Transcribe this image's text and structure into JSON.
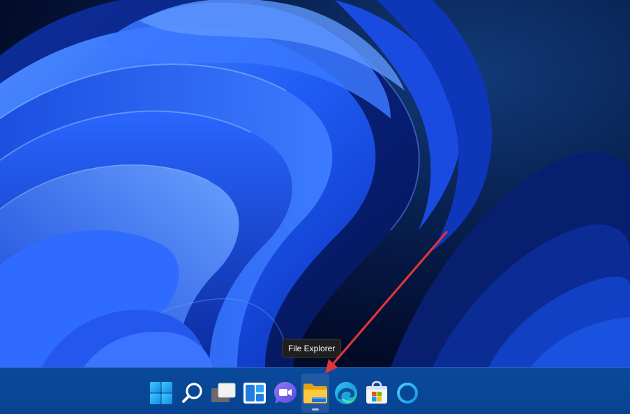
{
  "tooltip": {
    "text": "File Explorer"
  },
  "taskbar": {
    "items": [
      {
        "name": "start-button",
        "icon": "windows-logo-icon",
        "active": false
      },
      {
        "name": "search-button",
        "icon": "search-icon",
        "active": false
      },
      {
        "name": "task-view-button",
        "icon": "task-view-icon",
        "active": false
      },
      {
        "name": "widgets-button",
        "icon": "widgets-icon",
        "active": false
      },
      {
        "name": "teams-chat-button",
        "icon": "teams-chat-icon",
        "active": false
      },
      {
        "name": "file-explorer-button",
        "icon": "folder-icon",
        "active": true
      },
      {
        "name": "edge-button",
        "icon": "edge-icon",
        "active": false
      },
      {
        "name": "microsoft-store-button",
        "icon": "store-icon",
        "active": false
      },
      {
        "name": "cortana-button",
        "icon": "cortana-icon",
        "active": false
      }
    ]
  },
  "colors": {
    "taskbar": "#074393",
    "annotation_arrow": "#e0353b",
    "tooltip_bg": "#1f1f1f"
  }
}
